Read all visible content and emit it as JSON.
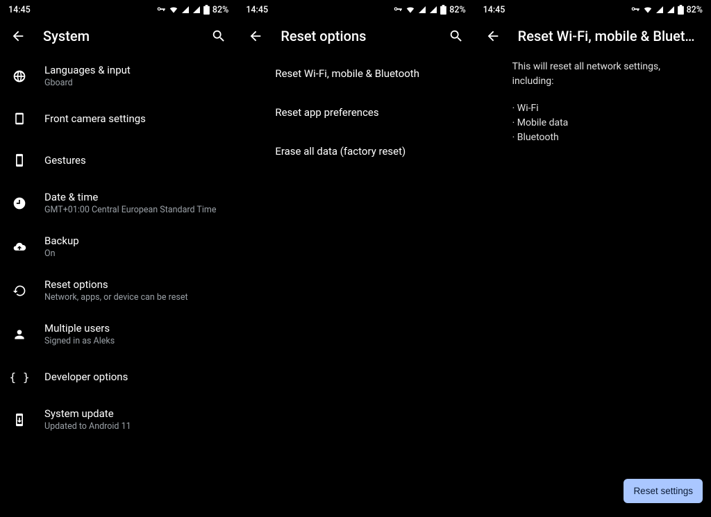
{
  "status": {
    "time": "14:45",
    "battery": "82%"
  },
  "panel1": {
    "title": "System",
    "items": [
      {
        "label": "Languages & input",
        "sub": "Gboard"
      },
      {
        "label": "Front camera settings",
        "sub": ""
      },
      {
        "label": "Gestures",
        "sub": ""
      },
      {
        "label": "Date & time",
        "sub": "GMT+01:00 Central European Standard Time"
      },
      {
        "label": "Backup",
        "sub": "On"
      },
      {
        "label": "Reset options",
        "sub": "Network, apps, or device can be reset"
      },
      {
        "label": "Multiple users",
        "sub": "Signed in as Aleks"
      },
      {
        "label": "Developer options",
        "sub": ""
      },
      {
        "label": "System update",
        "sub": "Updated to Android 11"
      }
    ]
  },
  "panel2": {
    "title": "Reset options",
    "items": [
      {
        "label": "Reset Wi-Fi, mobile & Bluetooth"
      },
      {
        "label": "Reset app preferences"
      },
      {
        "label": "Erase all data (factory reset)"
      }
    ]
  },
  "panel3": {
    "title": "Reset Wi-Fi, mobile & Blueto…",
    "intro": "This will reset all network settings, including:",
    "bullets": [
      "Wi-Fi",
      "Mobile data",
      "Bluetooth"
    ],
    "button": "Reset settings"
  }
}
